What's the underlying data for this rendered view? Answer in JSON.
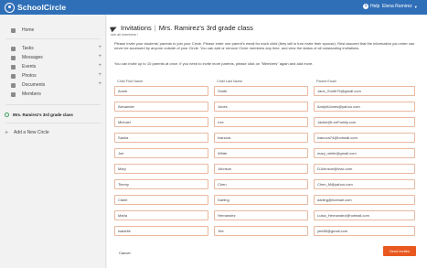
{
  "app": {
    "name": "SchoolCircle",
    "help_label": "Help",
    "user_name": "Elena Ramirez"
  },
  "sidebar": {
    "home": "Home",
    "items": [
      {
        "label": "Tasks",
        "plus": "+"
      },
      {
        "label": "Messages",
        "plus": "+"
      },
      {
        "label": "Events",
        "plus": "+"
      },
      {
        "label": "Photos",
        "plus": "+"
      },
      {
        "label": "Documents",
        "plus": "+"
      },
      {
        "label": "Members",
        "plus": ""
      }
    ],
    "circle_name": "Mrs. Ramirez's 3rd grade class",
    "add_circle": "Add a New Circle"
  },
  "page": {
    "title": "Invitations",
    "circle": "Mrs. Ramirez's 3rd grade class",
    "subtitle": "see all members ›",
    "intro": "Please invite your students' parents to join your Circle. Please enter one parent's email for each child (they will in turn invite their spouse). Rest assured that the information you enter can never be accessed by anyone outside of your Circle. You can add or remove Circle members any time, and view the status of all outstanding invitations.",
    "limit": "You can invite up to 10 parents at once. If you need to invite more parents, please click on \"Members\" again and add more.",
    "headers": {
      "first": "Child First Name",
      "last": "Child Last Name",
      "email": "Parent Email"
    },
    "rows": [
      {
        "first": "Annie",
        "last": "Smith",
        "email": "Jane_Smith75@gmail.com"
      },
      {
        "first": "Alexander",
        "last": "Jones",
        "email": "AndyMJones@yahoo.com"
      },
      {
        "first": "Michael",
        "last": "Lee",
        "email": "Jackie@LeeFamily.com"
      },
      {
        "first": "Sasha",
        "last": "Ivanova",
        "email": "ivanova74@hotmail.com"
      },
      {
        "first": "Joe",
        "last": "White",
        "email": "mary_white@gmail.com"
      },
      {
        "first": "Mary",
        "last": "Johnson",
        "email": "DJohnson@mac.com"
      },
      {
        "first": "Timmy",
        "last": "Chen",
        "email": "Chen_M@yahoo.com"
      },
      {
        "first": "Claire",
        "last": "Darling",
        "email": "darling@hotmail.com"
      },
      {
        "first": "Maria",
        "last": "Hernandez",
        "email": "Luisa_Hernandez@hotmail.com"
      },
      {
        "first": "Isabelle",
        "last": "Yee",
        "email": "yee85@gmail.com"
      }
    ],
    "cancel": "Cancel",
    "send": "Send Invites"
  }
}
